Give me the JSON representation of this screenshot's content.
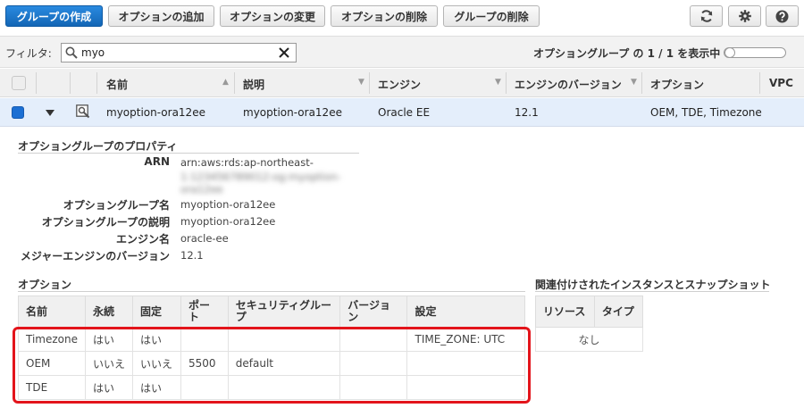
{
  "toolbar": {
    "create_group": "グループの作成",
    "add_option": "オプションの追加",
    "modify_option": "オプションの変更",
    "delete_option": "オプションの削除",
    "delete_group": "グループの削除"
  },
  "filter": {
    "label": "フィルタ:",
    "value": "myo",
    "count_text": "オプショングループ の 1 / 1 を表示中"
  },
  "table": {
    "headers": [
      "名前",
      "説明",
      "エンジン",
      "エンジンのバージョン",
      "オプション",
      "VPC"
    ],
    "row": {
      "name": "myoption-ora12ee",
      "description": "myoption-ora12ee",
      "engine": "Oracle EE",
      "engine_version": "12.1",
      "options": "OEM, TDE, Timezone"
    }
  },
  "properties": {
    "title": "オプショングループのプロパティ",
    "arn_label": "ARN",
    "arn_value": "arn:aws:rds:ap-northeast-",
    "arn_blur_1": "1:123456789012:og:myoption-",
    "arn_blur_2": "ora12ee",
    "name_label": "オプショングループ名",
    "name_value": "myoption-ora12ee",
    "desc_label": "オプショングループの説明",
    "desc_value": "myoption-ora12ee",
    "engine_label": "エンジン名",
    "engine_value": "oracle-ee",
    "major_label": "メジャーエンジンのバージョン",
    "major_value": "12.1"
  },
  "options": {
    "title": "オプション",
    "headers": [
      "名前",
      "永続",
      "固定",
      "ポート",
      "セキュリティグループ",
      "バージョン",
      "設定"
    ],
    "rows": [
      [
        "Timezone",
        "はい",
        "はい",
        "",
        "",
        "",
        "TIME_ZONE: UTC"
      ],
      [
        "OEM",
        "いいえ",
        "いいえ",
        "5500",
        "default",
        "",
        ""
      ],
      [
        "TDE",
        "はい",
        "はい",
        "",
        "",
        "",
        ""
      ]
    ]
  },
  "related": {
    "title": "関連付けされたインスタンスとスナップショット",
    "headers": [
      "リソース",
      "タイプ"
    ],
    "empty": "なし"
  },
  "colors": {
    "primary": "#1a73c8",
    "selected_row": "#e4eefb",
    "highlight": "#e3141b"
  }
}
